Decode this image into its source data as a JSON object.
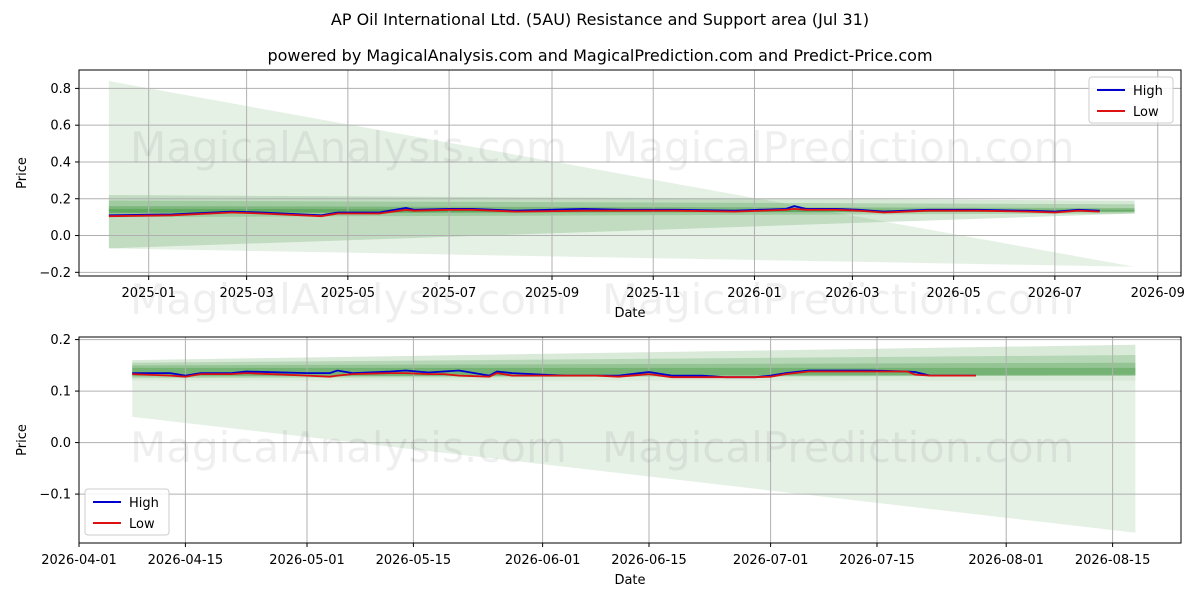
{
  "title": "AP Oil International Ltd. (5AU) Resistance and Support area (Jul 31)",
  "subtitle": "powered by MagicalAnalysis.com and MagicalPrediction.com and Predict-Price.com",
  "watermarks": [
    "MagicalAnalysis.com",
    "MagicalPrediction.com"
  ],
  "colors": {
    "high": "#0000cc",
    "low": "#dd1111",
    "band": "#2e8b2e",
    "grid": "#b0b0b0"
  },
  "chart_data": [
    {
      "type": "line",
      "xlabel": "Date",
      "ylabel": "Price",
      "grid": true,
      "legend": {
        "position": "top-right",
        "entries": [
          "High",
          "Low"
        ]
      },
      "ylim": [
        -0.22,
        0.9
      ],
      "xlim": [
        "2024-11-20",
        "2026-09-15"
      ],
      "yticks": [
        -0.2,
        0.0,
        0.2,
        0.4,
        0.6,
        0.8
      ],
      "ytick_labels": [
        "−0.2",
        "0.0",
        "0.2",
        "0.4",
        "0.6",
        "0.8"
      ],
      "xticks": [
        "2025-01-01",
        "2025-03-01",
        "2025-05-01",
        "2025-07-01",
        "2025-09-01",
        "2025-11-01",
        "2026-01-01",
        "2026-03-01",
        "2026-05-01",
        "2026-07-01",
        "2026-09-01"
      ],
      "xtick_labels": [
        "2025-01",
        "2025-03",
        "2025-05",
        "2025-07",
        "2025-09",
        "2025-11",
        "2026-01",
        "2026-03",
        "2026-05",
        "2026-07",
        "2026-09"
      ],
      "bands": [
        {
          "x": [
            "2024-12-08",
            "2026-08-18"
          ],
          "upper": [
            0.84,
            -0.17
          ],
          "lower": [
            -0.07,
            -0.17
          ],
          "opacity": 0.12
        },
        {
          "x": [
            "2024-12-08",
            "2026-08-18"
          ],
          "upper": [
            0.84,
            0.19
          ],
          "lower": [
            0.84,
            -0.17
          ],
          "opacity": 0.0
        },
        {
          "x": [
            "2024-12-08",
            "2026-08-18"
          ],
          "upper": [
            0.22,
            0.19
          ],
          "lower": [
            -0.07,
            0.12
          ],
          "opacity": 0.2
        },
        {
          "x": [
            "2024-12-08",
            "2026-08-18"
          ],
          "upper": [
            0.19,
            0.17
          ],
          "lower": [
            0.1,
            0.12
          ],
          "opacity": 0.22
        },
        {
          "x": [
            "2024-12-08",
            "2026-08-18"
          ],
          "upper": [
            0.16,
            0.15
          ],
          "lower": [
            0.12,
            0.13
          ],
          "opacity": 0.3
        },
        {
          "x": [
            "2024-12-08",
            "2026-08-18"
          ],
          "upper": [
            0.145,
            0.14
          ],
          "lower": [
            0.125,
            0.13
          ],
          "opacity": 0.35
        }
      ],
      "series": [
        {
          "name": "High",
          "x": [
            "2024-12-08",
            "2025-01-15",
            "2025-02-20",
            "2025-03-10",
            "2025-04-15",
            "2025-04-25",
            "2025-05-20",
            "2025-06-05",
            "2025-06-10",
            "2025-07-01",
            "2025-07-15",
            "2025-08-10",
            "2025-09-20",
            "2025-10-15",
            "2025-11-15",
            "2025-12-20",
            "2026-01-20",
            "2026-01-25",
            "2026-02-01",
            "2026-02-20",
            "2026-03-05",
            "2026-03-20",
            "2026-04-15",
            "2026-05-15",
            "2026-06-15",
            "2026-07-01",
            "2026-07-15",
            "2026-07-28"
          ],
          "values": [
            0.11,
            0.115,
            0.13,
            0.125,
            0.11,
            0.125,
            0.125,
            0.15,
            0.14,
            0.145,
            0.145,
            0.135,
            0.145,
            0.14,
            0.14,
            0.135,
            0.145,
            0.16,
            0.145,
            0.145,
            0.14,
            0.13,
            0.14,
            0.14,
            0.135,
            0.13,
            0.14,
            0.135
          ]
        },
        {
          "name": "Low",
          "x": [
            "2024-12-08",
            "2025-01-15",
            "2025-02-20",
            "2025-03-10",
            "2025-04-15",
            "2025-04-25",
            "2025-05-20",
            "2025-06-05",
            "2025-06-10",
            "2025-07-01",
            "2025-07-15",
            "2025-08-10",
            "2025-09-20",
            "2025-10-15",
            "2025-11-15",
            "2025-12-20",
            "2026-01-20",
            "2026-01-25",
            "2026-02-01",
            "2026-02-20",
            "2026-03-05",
            "2026-03-20",
            "2026-04-15",
            "2026-05-15",
            "2026-06-15",
            "2026-07-01",
            "2026-07-15",
            "2026-07-28"
          ],
          "values": [
            0.105,
            0.11,
            0.125,
            0.12,
            0.105,
            0.12,
            0.12,
            0.14,
            0.135,
            0.14,
            0.14,
            0.13,
            0.135,
            0.135,
            0.135,
            0.13,
            0.14,
            0.145,
            0.14,
            0.14,
            0.135,
            0.125,
            0.135,
            0.135,
            0.13,
            0.125,
            0.135,
            0.13
          ]
        }
      ]
    },
    {
      "type": "line",
      "xlabel": "Date",
      "ylabel": "Price",
      "grid": true,
      "legend": {
        "position": "bottom-left",
        "entries": [
          "High",
          "Low"
        ]
      },
      "ylim": [
        -0.195,
        0.205
      ],
      "xlim": [
        "2026-04-01",
        "2026-08-24"
      ],
      "yticks": [
        -0.1,
        0.0,
        0.1,
        0.2
      ],
      "ytick_labels": [
        "−0.1",
        "0.0",
        "0.1",
        "0.2"
      ],
      "xticks": [
        "2026-04-01",
        "2026-04-15",
        "2026-05-01",
        "2026-05-15",
        "2026-06-01",
        "2026-06-15",
        "2026-07-01",
        "2026-07-15",
        "2026-08-01",
        "2026-08-15"
      ],
      "xtick_labels": [
        "2026-04-01",
        "2026-04-15",
        "2026-05-01",
        "2026-05-15",
        "2026-06-01",
        "2026-06-15",
        "2026-07-01",
        "2026-07-15",
        "2026-08-01",
        "2026-08-15"
      ],
      "bands": [
        {
          "x": [
            "2026-04-08",
            "2026-08-18"
          ],
          "upper": [
            0.12,
            0.12
          ],
          "lower": [
            0.05,
            -0.175
          ],
          "opacity": 0.12
        },
        {
          "x": [
            "2026-04-08",
            "2026-08-18"
          ],
          "upper": [
            0.16,
            0.19
          ],
          "lower": [
            0.12,
            0.12
          ],
          "opacity": 0.18
        },
        {
          "x": [
            "2026-04-08",
            "2026-08-18"
          ],
          "upper": [
            0.155,
            0.17
          ],
          "lower": [
            0.125,
            0.13
          ],
          "opacity": 0.2
        },
        {
          "x": [
            "2026-04-08",
            "2026-08-18"
          ],
          "upper": [
            0.15,
            0.155
          ],
          "lower": [
            0.128,
            0.132
          ],
          "opacity": 0.25
        },
        {
          "x": [
            "2026-04-08",
            "2026-08-18"
          ],
          "upper": [
            0.145,
            0.145
          ],
          "lower": [
            0.13,
            0.13
          ],
          "opacity": 0.3
        }
      ],
      "series": [
        {
          "name": "High",
          "x": [
            "2026-04-08",
            "2026-04-13",
            "2026-04-15",
            "2026-04-17",
            "2026-04-21",
            "2026-04-23",
            "2026-05-01",
            "2026-05-04",
            "2026-05-05",
            "2026-05-07",
            "2026-05-12",
            "2026-05-14",
            "2026-05-17",
            "2026-05-19",
            "2026-05-21",
            "2026-05-25",
            "2026-05-26",
            "2026-05-28",
            "2026-06-01",
            "2026-06-04",
            "2026-06-08",
            "2026-06-11",
            "2026-06-15",
            "2026-06-18",
            "2026-06-22",
            "2026-06-25",
            "2026-06-29",
            "2026-07-01",
            "2026-07-03",
            "2026-07-06",
            "2026-07-10",
            "2026-07-14",
            "2026-07-19",
            "2026-07-20",
            "2026-07-22",
            "2026-07-28"
          ],
          "values": [
            0.135,
            0.135,
            0.13,
            0.135,
            0.135,
            0.138,
            0.135,
            0.135,
            0.14,
            0.135,
            0.138,
            0.14,
            0.136,
            0.138,
            0.14,
            0.13,
            0.138,
            0.135,
            0.132,
            0.13,
            0.13,
            0.13,
            0.137,
            0.13,
            0.13,
            0.127,
            0.127,
            0.13,
            0.135,
            0.14,
            0.14,
            0.14,
            0.138,
            0.137,
            0.13,
            0.13
          ]
        },
        {
          "name": "Low",
          "x": [
            "2026-04-08",
            "2026-04-13",
            "2026-04-15",
            "2026-04-17",
            "2026-04-21",
            "2026-04-23",
            "2026-05-01",
            "2026-05-04",
            "2026-05-05",
            "2026-05-07",
            "2026-05-12",
            "2026-05-14",
            "2026-05-17",
            "2026-05-19",
            "2026-05-21",
            "2026-05-25",
            "2026-05-26",
            "2026-05-28",
            "2026-06-01",
            "2026-06-04",
            "2026-06-08",
            "2026-06-11",
            "2026-06-15",
            "2026-06-18",
            "2026-06-22",
            "2026-06-25",
            "2026-06-29",
            "2026-07-01",
            "2026-07-03",
            "2026-07-06",
            "2026-07-10",
            "2026-07-14",
            "2026-07-19",
            "2026-07-20",
            "2026-07-22",
            "2026-07-28"
          ],
          "values": [
            0.133,
            0.13,
            0.128,
            0.133,
            0.133,
            0.135,
            0.13,
            0.128,
            0.13,
            0.133,
            0.135,
            0.135,
            0.133,
            0.133,
            0.13,
            0.128,
            0.135,
            0.13,
            0.13,
            0.13,
            0.13,
            0.128,
            0.133,
            0.127,
            0.127,
            0.127,
            0.127,
            0.128,
            0.133,
            0.138,
            0.138,
            0.138,
            0.138,
            0.132,
            0.13,
            0.13
          ]
        }
      ]
    }
  ]
}
